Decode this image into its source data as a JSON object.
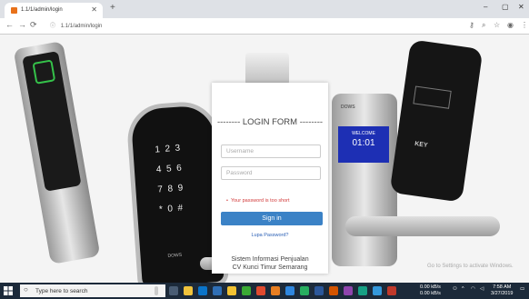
{
  "browser": {
    "tab_title": "1.1/1/admin/login",
    "address": "1.1/1/admin/login",
    "window_controls": [
      "–",
      "▢",
      "✕"
    ]
  },
  "login": {
    "title": "-------- LOGIN FORM --------",
    "username_placeholder": "Username",
    "password_placeholder": "Password",
    "error": "Your password is too short",
    "signin_label": "Sign in",
    "forgot_label": "Lupa Password?",
    "system_line1": "Sistem Informasi Penjualan",
    "system_line2": "CV Kunci Timur Semarang"
  },
  "background_text": {
    "brand1": "DOWS",
    "brand2": "DOWS",
    "welcome": "WELCOME",
    "time": "01:01",
    "key": "KEY",
    "activate": "Go to Settings to activate Windows."
  },
  "taskbar": {
    "search_placeholder": "Type here to search",
    "net_up": "0.00 kB/s",
    "net_down": "0.00 kB/s",
    "time": "7:58 AM",
    "date": "3/27/2019"
  },
  "colors": {
    "signin": "#3b82c6",
    "error": "#d23b3b",
    "taskbar": "#1c2a3a"
  }
}
